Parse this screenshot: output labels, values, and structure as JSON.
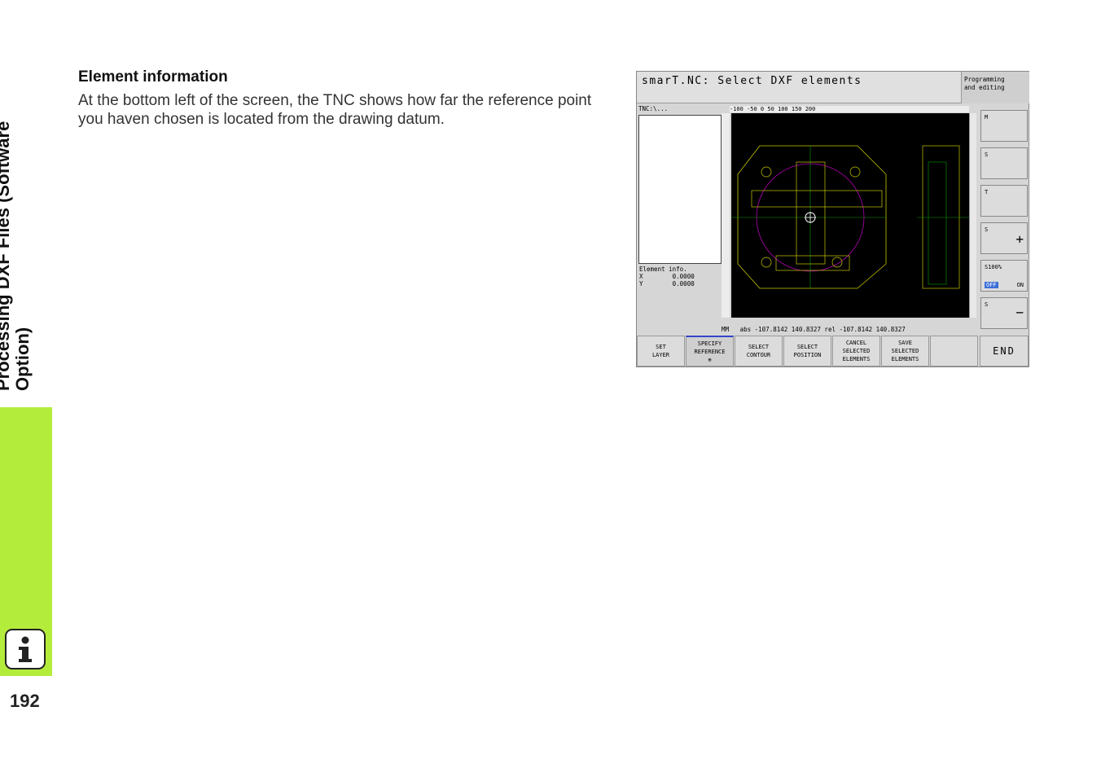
{
  "sidebar": {
    "chapter_title_line1": "Processing DXF Files (Software",
    "chapter_title_line2": "Option)",
    "info_icon": "info-icon",
    "page_number": "192",
    "tab_color": "#b4ec3c"
  },
  "content": {
    "heading": "Element information",
    "body": "At the bottom left of the screen, the TNC shows how far the reference point you haven chosen is located from the drawing datum."
  },
  "screenshot": {
    "title": "smarT.NC: Select DXF elements",
    "mode_line1": "Programming",
    "mode_line2": "and editing",
    "path": "TNC:\\...",
    "element_info_label": "Element info.",
    "x_label": "X",
    "x_value": "0.0000",
    "y_label": "Y",
    "y_value": "0.0000",
    "ruler_top": "-100   -50    0     50    100   150   200",
    "coords_line": "MM   abs -107.8142 140.8327 rel -107.8142 140.8327",
    "right_buttons": [
      {
        "label": "M",
        "icon": "machine-table-icon"
      },
      {
        "label": "S",
        "icon": "spindle-icon"
      },
      {
        "label": "T",
        "icon": "tool-change-icon"
      },
      {
        "label": "S",
        "icon": "spindle-plus-icon"
      },
      {
        "label": "S100%",
        "icon": "spindle-override-icon",
        "off": "OFF",
        "on": "ON"
      },
      {
        "label": "S",
        "icon": "spindle-minus-icon"
      }
    ],
    "softkeys": [
      {
        "line1": "SET",
        "line2": "LAYER"
      },
      {
        "line1": "SPECIFY",
        "line2": "REFERENCE"
      },
      {
        "line1": "SELECT",
        "line2": "CONTOUR"
      },
      {
        "line1": "SELECT",
        "line2": "POSITION"
      },
      {
        "line1": "CANCEL",
        "line2": "SELECTED",
        "line3": "ELEMENTS"
      },
      {
        "line1": "SAVE",
        "line2": "SELECTED",
        "line3": "ELEMENTS"
      },
      {
        "line1": ""
      },
      {
        "line1": "END"
      }
    ]
  }
}
